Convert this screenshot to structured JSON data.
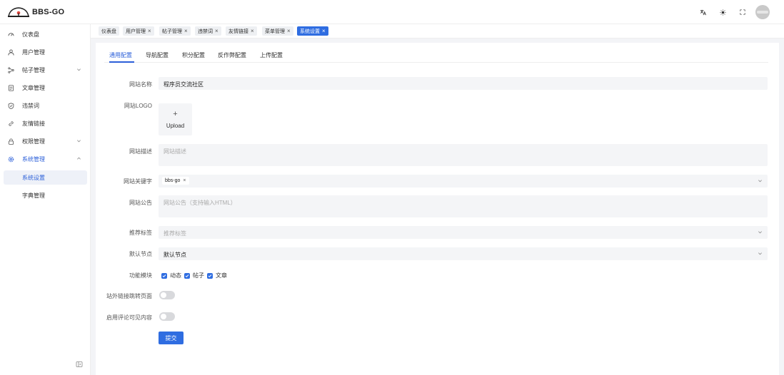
{
  "app": {
    "title": "BBS-GO"
  },
  "header_icons": [
    "translate-icon",
    "theme-sun-icon",
    "fullscreen-icon"
  ],
  "sidebar": {
    "items": [
      {
        "label": "仪表盘",
        "icon": "dashboard-icon"
      },
      {
        "label": "用户管理",
        "icon": "user-icon"
      },
      {
        "label": "帖子管理",
        "icon": "share-icon",
        "expandable": true
      },
      {
        "label": "文章管理",
        "icon": "document-icon"
      },
      {
        "label": "违禁词",
        "icon": "shield-icon"
      },
      {
        "label": "友情链接",
        "icon": "link-icon"
      },
      {
        "label": "权限管理",
        "icon": "lock-icon",
        "expandable": true
      },
      {
        "label": "系统管理",
        "icon": "gear-icon",
        "expandable": true,
        "expanded": true
      },
      {
        "label": "系统设置",
        "sub": true,
        "selected": true
      },
      {
        "label": "字典管理",
        "sub": true
      }
    ],
    "collapse_icon": "collapse-icon"
  },
  "tabs": [
    {
      "label": "仪表盘",
      "closable": false
    },
    {
      "label": "用户管理",
      "closable": true
    },
    {
      "label": "帖子管理",
      "closable": true
    },
    {
      "label": "违禁词",
      "closable": true
    },
    {
      "label": "友情链接",
      "closable": true
    },
    {
      "label": "菜单管理",
      "closable": true
    },
    {
      "label": "系统设置",
      "closable": true,
      "active": true
    }
  ],
  "subtabs": [
    "通用配置",
    "导航配置",
    "积分配置",
    "反作弊配置",
    "上传配置"
  ],
  "form": {
    "site_name": {
      "label": "网站名称",
      "value": "程序员交流社区"
    },
    "site_logo": {
      "label": "网站LOGO",
      "upload_label": "Upload",
      "plus": "+"
    },
    "site_desc": {
      "label": "网站描述",
      "placeholder": "网站描述"
    },
    "site_keywords": {
      "label": "网站关键字",
      "tags": [
        "bbs-go"
      ]
    },
    "site_notice": {
      "label": "网站公告",
      "placeholder": "网站公告（支持输入HTML）"
    },
    "recommend_tags": {
      "label": "推荐标签",
      "placeholder": "推荐标签"
    },
    "default_node": {
      "label": "默认节点",
      "value": "默认节点"
    },
    "modules": {
      "label": "功能模块",
      "options": [
        {
          "label": "动态",
          "checked": true
        },
        {
          "label": "帖子",
          "checked": true
        },
        {
          "label": "文章",
          "checked": true
        }
      ]
    },
    "external_link_redirect": {
      "label": "站外链接跳转页面",
      "on": false
    },
    "comment_visible": {
      "label": "启用评论可见内容",
      "on": false
    },
    "submit_label": "提交"
  },
  "colors": {
    "primary": "#2f6de1",
    "field_bg": "#f4f5f7",
    "page_bg": "#f3f4f7"
  }
}
